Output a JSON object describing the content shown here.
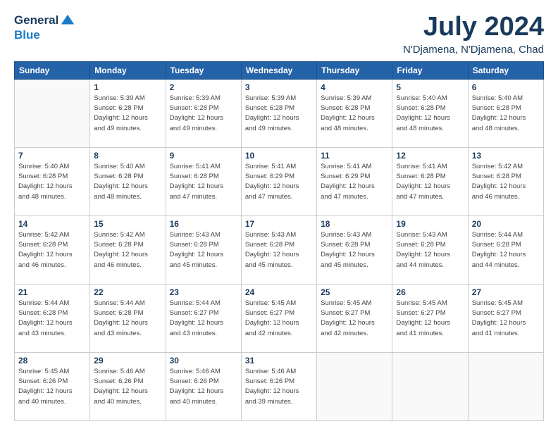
{
  "logo": {
    "general": "General",
    "blue": "Blue"
  },
  "title": {
    "month": "July 2024",
    "location": "N'Djamena, N'Djamena, Chad"
  },
  "header": {
    "days": [
      "Sunday",
      "Monday",
      "Tuesday",
      "Wednesday",
      "Thursday",
      "Friday",
      "Saturday"
    ]
  },
  "weeks": [
    {
      "cells": [
        {
          "day": "",
          "info": ""
        },
        {
          "day": "1",
          "info": "Sunrise: 5:39 AM\nSunset: 6:28 PM\nDaylight: 12 hours\nand 49 minutes."
        },
        {
          "day": "2",
          "info": "Sunrise: 5:39 AM\nSunset: 6:28 PM\nDaylight: 12 hours\nand 49 minutes."
        },
        {
          "day": "3",
          "info": "Sunrise: 5:39 AM\nSunset: 6:28 PM\nDaylight: 12 hours\nand 49 minutes."
        },
        {
          "day": "4",
          "info": "Sunrise: 5:39 AM\nSunset: 6:28 PM\nDaylight: 12 hours\nand 48 minutes."
        },
        {
          "day": "5",
          "info": "Sunrise: 5:40 AM\nSunset: 6:28 PM\nDaylight: 12 hours\nand 48 minutes."
        },
        {
          "day": "6",
          "info": "Sunrise: 5:40 AM\nSunset: 6:28 PM\nDaylight: 12 hours\nand 48 minutes."
        }
      ]
    },
    {
      "cells": [
        {
          "day": "7",
          "info": "Sunrise: 5:40 AM\nSunset: 6:28 PM\nDaylight: 12 hours\nand 48 minutes."
        },
        {
          "day": "8",
          "info": "Sunrise: 5:40 AM\nSunset: 6:28 PM\nDaylight: 12 hours\nand 48 minutes."
        },
        {
          "day": "9",
          "info": "Sunrise: 5:41 AM\nSunset: 6:28 PM\nDaylight: 12 hours\nand 47 minutes."
        },
        {
          "day": "10",
          "info": "Sunrise: 5:41 AM\nSunset: 6:29 PM\nDaylight: 12 hours\nand 47 minutes."
        },
        {
          "day": "11",
          "info": "Sunrise: 5:41 AM\nSunset: 6:29 PM\nDaylight: 12 hours\nand 47 minutes."
        },
        {
          "day": "12",
          "info": "Sunrise: 5:41 AM\nSunset: 6:28 PM\nDaylight: 12 hours\nand 47 minutes."
        },
        {
          "day": "13",
          "info": "Sunrise: 5:42 AM\nSunset: 6:28 PM\nDaylight: 12 hours\nand 46 minutes."
        }
      ]
    },
    {
      "cells": [
        {
          "day": "14",
          "info": "Sunrise: 5:42 AM\nSunset: 6:28 PM\nDaylight: 12 hours\nand 46 minutes."
        },
        {
          "day": "15",
          "info": "Sunrise: 5:42 AM\nSunset: 6:28 PM\nDaylight: 12 hours\nand 46 minutes."
        },
        {
          "day": "16",
          "info": "Sunrise: 5:43 AM\nSunset: 6:28 PM\nDaylight: 12 hours\nand 45 minutes."
        },
        {
          "day": "17",
          "info": "Sunrise: 5:43 AM\nSunset: 6:28 PM\nDaylight: 12 hours\nand 45 minutes."
        },
        {
          "day": "18",
          "info": "Sunrise: 5:43 AM\nSunset: 6:28 PM\nDaylight: 12 hours\nand 45 minutes."
        },
        {
          "day": "19",
          "info": "Sunrise: 5:43 AM\nSunset: 6:28 PM\nDaylight: 12 hours\nand 44 minutes."
        },
        {
          "day": "20",
          "info": "Sunrise: 5:44 AM\nSunset: 6:28 PM\nDaylight: 12 hours\nand 44 minutes."
        }
      ]
    },
    {
      "cells": [
        {
          "day": "21",
          "info": "Sunrise: 5:44 AM\nSunset: 6:28 PM\nDaylight: 12 hours\nand 43 minutes."
        },
        {
          "day": "22",
          "info": "Sunrise: 5:44 AM\nSunset: 6:28 PM\nDaylight: 12 hours\nand 43 minutes."
        },
        {
          "day": "23",
          "info": "Sunrise: 5:44 AM\nSunset: 6:27 PM\nDaylight: 12 hours\nand 43 minutes."
        },
        {
          "day": "24",
          "info": "Sunrise: 5:45 AM\nSunset: 6:27 PM\nDaylight: 12 hours\nand 42 minutes."
        },
        {
          "day": "25",
          "info": "Sunrise: 5:45 AM\nSunset: 6:27 PM\nDaylight: 12 hours\nand 42 minutes."
        },
        {
          "day": "26",
          "info": "Sunrise: 5:45 AM\nSunset: 6:27 PM\nDaylight: 12 hours\nand 41 minutes."
        },
        {
          "day": "27",
          "info": "Sunrise: 5:45 AM\nSunset: 6:27 PM\nDaylight: 12 hours\nand 41 minutes."
        }
      ]
    },
    {
      "cells": [
        {
          "day": "28",
          "info": "Sunrise: 5:45 AM\nSunset: 6:26 PM\nDaylight: 12 hours\nand 40 minutes."
        },
        {
          "day": "29",
          "info": "Sunrise: 5:46 AM\nSunset: 6:26 PM\nDaylight: 12 hours\nand 40 minutes."
        },
        {
          "day": "30",
          "info": "Sunrise: 5:46 AM\nSunset: 6:26 PM\nDaylight: 12 hours\nand 40 minutes."
        },
        {
          "day": "31",
          "info": "Sunrise: 5:46 AM\nSunset: 6:26 PM\nDaylight: 12 hours\nand 39 minutes."
        },
        {
          "day": "",
          "info": ""
        },
        {
          "day": "",
          "info": ""
        },
        {
          "day": "",
          "info": ""
        }
      ]
    }
  ]
}
